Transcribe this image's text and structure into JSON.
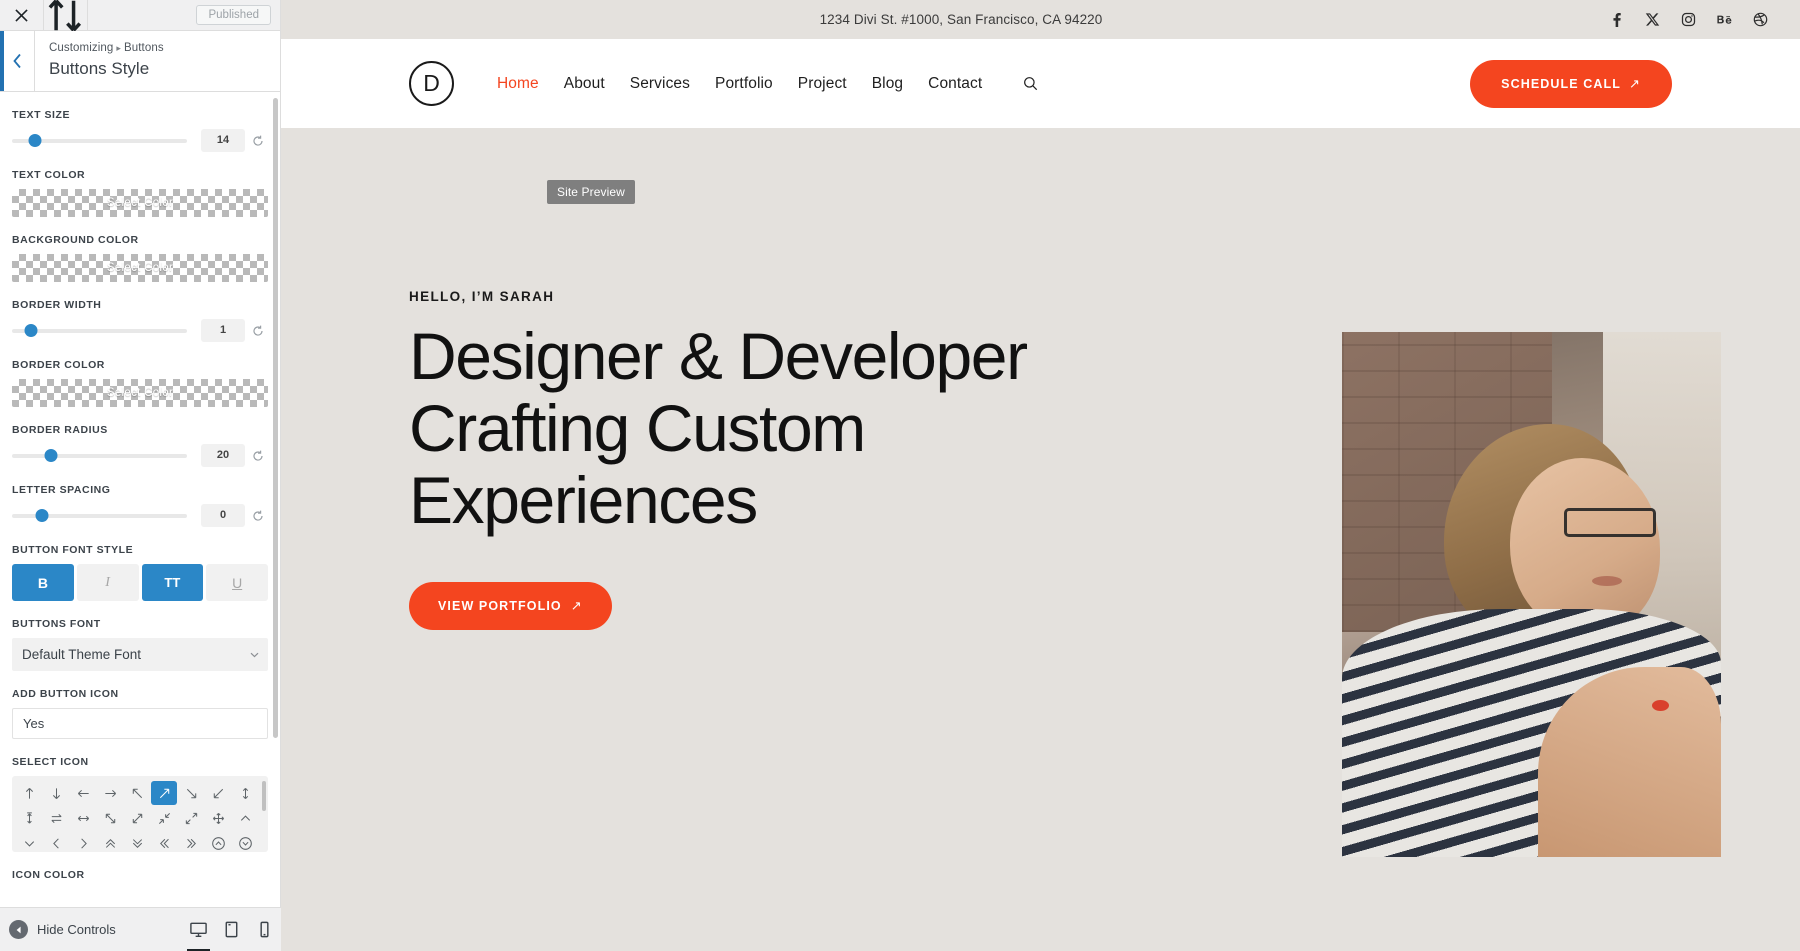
{
  "customizer": {
    "topbar": {
      "close_icon": "close-icon",
      "devices_icon": "collapse-sidebar-icon",
      "publish_label": "Published"
    },
    "header": {
      "back_icon": "chevron-left-icon",
      "breadcrumb_root": "Customizing",
      "breadcrumb_separator": "▸",
      "breadcrumb_current": "Buttons",
      "title": "Buttons Style"
    },
    "controls": [
      {
        "type": "range",
        "label": "TEXT SIZE",
        "value": "14",
        "thumb_pct": 13
      },
      {
        "type": "color",
        "label": "TEXT COLOR",
        "placeholder": "Select Color"
      },
      {
        "type": "color",
        "label": "BACKGROUND COLOR",
        "placeholder": "Select Color"
      },
      {
        "type": "range",
        "label": "BORDER WIDTH",
        "value": "1",
        "thumb_pct": 11
      },
      {
        "type": "color",
        "label": "BORDER COLOR",
        "placeholder": "Select Color"
      },
      {
        "type": "range",
        "label": "BORDER RADIUS",
        "value": "20",
        "thumb_pct": 22
      },
      {
        "type": "range",
        "label": "LETTER SPACING",
        "value": "0",
        "thumb_pct": 17
      }
    ],
    "font_style": {
      "label": "BUTTON FONT STYLE",
      "buttons": [
        {
          "name": "bold",
          "glyph": "B",
          "active": true
        },
        {
          "name": "italic",
          "glyph": "I",
          "active": false
        },
        {
          "name": "uppercase",
          "glyph": "TT",
          "active": true
        },
        {
          "name": "underline",
          "glyph": "U",
          "active": false
        }
      ]
    },
    "buttons_font": {
      "label": "BUTTONS FONT",
      "value": "Default Theme Font"
    },
    "add_button_icon": {
      "label": "ADD BUTTON ICON",
      "value": "Yes"
    },
    "select_icon": {
      "label": "SELECT ICON",
      "selected_index": 5,
      "icons": [
        "arrow-up-icon",
        "arrow-down-icon",
        "arrow-left-icon",
        "arrow-right-icon",
        "arrow-up-left-icon",
        "arrow-up-right-icon",
        "arrow-down-right-icon",
        "arrow-down-left-icon",
        "arrow-up-down-icon",
        "arrow-up-down-bar-icon",
        "arrow-swap-icon",
        "arrow-left-right-icon",
        "arrow-diagonal-nwse-icon",
        "arrow-diagonal-nesw-icon",
        "arrows-collapse-icon",
        "arrows-expand-icon",
        "arrows-move-icon",
        "chevron-up-icon",
        "chevron-down-icon",
        "chevron-left-icon",
        "chevron-right-icon",
        "chevrons-up-icon",
        "chevrons-down-icon",
        "chevrons-left-icon",
        "chevrons-right-icon",
        "circle-chevron-up-icon",
        "circle-chevron-down-icon"
      ]
    },
    "icon_color": {
      "label": "ICON COLOR"
    },
    "footer": {
      "hide_controls_label": "Hide Controls",
      "hide_icon": "collapse-arrow-icon",
      "devices": [
        {
          "name": "desktop-view",
          "active": true
        },
        {
          "name": "tablet-view",
          "active": false
        },
        {
          "name": "mobile-view",
          "active": false
        }
      ]
    }
  },
  "preview": {
    "tooltip": "Site Preview",
    "topbar": {
      "address": "1234 Divi St. #1000, San Francisco, CA 94220",
      "social": [
        "facebook-icon",
        "x-twitter-icon",
        "instagram-icon",
        "behance-icon",
        "dribbble-icon"
      ]
    },
    "nav": {
      "logo_letter": "D",
      "menu": [
        {
          "label": "Home",
          "active": true
        },
        {
          "label": "About",
          "active": false
        },
        {
          "label": "Services",
          "active": false
        },
        {
          "label": "Portfolio",
          "active": false
        },
        {
          "label": "Project",
          "active": false
        },
        {
          "label": "Blog",
          "active": false
        },
        {
          "label": "Contact",
          "active": false
        }
      ],
      "search_icon": "search-icon",
      "cta_label": "SCHEDULE CALL",
      "cta_arrow": "↗"
    },
    "hero": {
      "eyebrow": "HELLO, I’M SARAH",
      "title_line1": "Designer & Developer",
      "title_line2": "Crafting Custom",
      "title_line3": "Experiences",
      "button_label": "VIEW PORTFOLIO",
      "button_arrow": "↗",
      "photo_alt": "woman-with-glasses-photo"
    }
  },
  "colors": {
    "accent_orange": "#f4451f",
    "customizer_blue": "#2b87c7",
    "hero_bg": "#e4e1dd"
  }
}
